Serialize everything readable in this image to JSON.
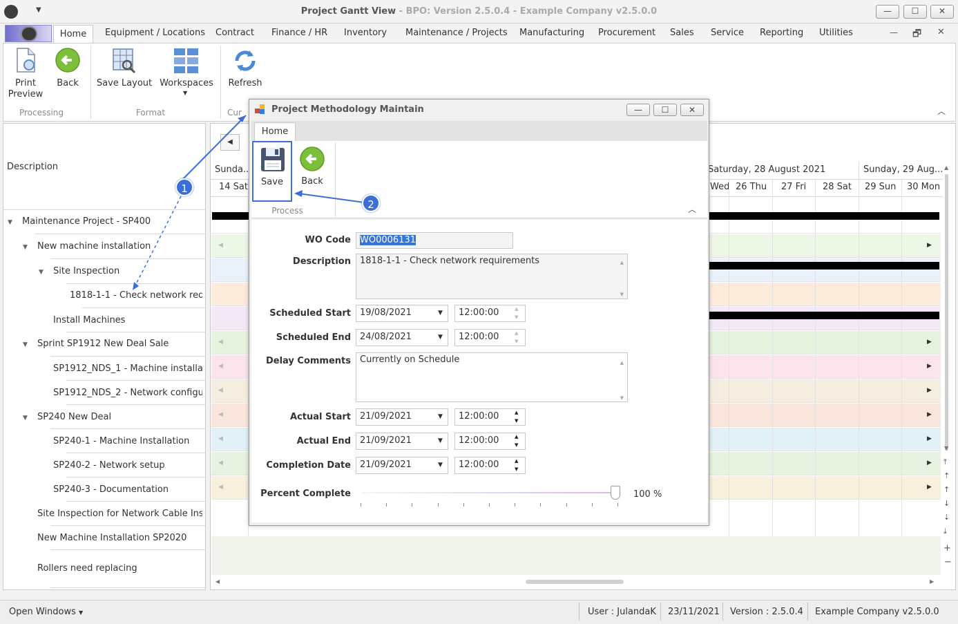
{
  "window": {
    "title": "Project Gantt View",
    "subtitle": "- BPO: Version 2.5.0.4 - Example Company v2.5.0.0",
    "minimize": "—",
    "maximize": "☐",
    "close": "✕"
  },
  "menu": {
    "items": [
      "Home",
      "Equipment / Locations",
      "Contract",
      "Finance / HR",
      "Inventory",
      "Maintenance / Projects",
      "Manufacturing",
      "Procurement",
      "Sales",
      "Service",
      "Reporting",
      "Utilities"
    ],
    "mdi_min": "—",
    "mdi_restore": "🗗",
    "mdi_close": "✕"
  },
  "ribbon": {
    "print_preview_line1": "Print",
    "print_preview_line2": "Preview",
    "back": "Back",
    "save_layout": "Save Layout",
    "workspaces": "Workspaces",
    "refresh": "Refresh",
    "group_processing": "Processing",
    "group_format": "Format",
    "group_cur": "Cur"
  },
  "tree": {
    "header": "Description",
    "items": [
      {
        "label": "Maintenance Project - SP400",
        "level": 0,
        "caret": "▼"
      },
      {
        "label": "New machine installation",
        "level": 1,
        "caret": "▼"
      },
      {
        "label": "Site Inspection",
        "level": 2,
        "caret": "▼"
      },
      {
        "label": "1818-1-1 - Check network req...",
        "level": 3,
        "caret": ""
      },
      {
        "label": "Install Machines",
        "level": 2,
        "caret": ""
      },
      {
        "label": "Sprint SP1912 New Deal Sale",
        "level": 1,
        "caret": "▼"
      },
      {
        "label": "SP1912_NDS_1 - Machine installat...",
        "level": 2,
        "caret": ""
      },
      {
        "label": "SP1912_NDS_2 - Network configu...",
        "level": 2,
        "caret": ""
      },
      {
        "label": "SP240 New Deal",
        "level": 1,
        "caret": "▼"
      },
      {
        "label": "SP240-1 - Machine Installation",
        "level": 2,
        "caret": ""
      },
      {
        "label": "SP240-2 - Network setup",
        "level": 2,
        "caret": ""
      },
      {
        "label": "SP240-3 - Documentation",
        "level": 2,
        "caret": ""
      },
      {
        "label": "Site Inspection for Network Cable Ins...",
        "level": 1,
        "caret": ""
      },
      {
        "label": "New Machine Installation SP2020",
        "level": 1,
        "caret": ""
      },
      {
        "label": "Rollers need replacing",
        "level": 1,
        "caret": ""
      }
    ]
  },
  "gantt": {
    "left_day_header": "Sunda...",
    "left_day": "14 Sat",
    "date_header_1": "Saturday, 28 August 2021",
    "date_header_2": "Sunday, 29 Aug...",
    "days": [
      "Wed",
      "26 Thu",
      "27 Fri",
      "28 Sat",
      "29 Sun",
      "30 Mon"
    ],
    "row_colors": [
      "#ffffff",
      "#edf7e6",
      "#e9f2fa",
      "#fdebdc",
      "#f3e8f6",
      "#e5f4df",
      "#fbe4ec",
      "#f5eee0",
      "#fbe6de",
      "#e2f1f8",
      "#e7f3e0",
      "#f8f0dc"
    ]
  },
  "dialog": {
    "title": "Project Methodology Maintain",
    "tab": "Home",
    "save": "Save",
    "back": "Back",
    "group_process": "Process",
    "fields": {
      "wo_code_label": "WO Code",
      "wo_code": "WO0006131",
      "description_label": "Description",
      "description": "1818-1-1 - Check network requirements",
      "sched_start_label": "Scheduled Start",
      "sched_start_date": "19/08/2021",
      "sched_start_time": "12:00:00",
      "sched_end_label": "Scheduled End",
      "sched_end_date": "24/08/2021",
      "sched_end_time": "12:00:00",
      "delay_label": "Delay Comments",
      "delay": "Currently on Schedule",
      "actual_start_label": "Actual Start",
      "actual_start_date": "21/09/2021",
      "actual_start_time": "12:00:00",
      "actual_end_label": "Actual End",
      "actual_end_date": "21/09/2021",
      "actual_end_time": "12:00:00",
      "completion_label": "Completion Date",
      "completion_date": "21/09/2021",
      "completion_time": "12:00:00",
      "percent_label": "Percent Complete",
      "percent_value": "100 %",
      "percent_fraction": 1.0
    }
  },
  "callouts": {
    "one": "1",
    "two": "2"
  },
  "status": {
    "open_windows": "Open Windows",
    "user": "User : JulandaK",
    "date": "23/11/2021",
    "version": "Version : 2.5.0.4",
    "company": "Example Company v2.5.0.0"
  },
  "colors": {
    "accent": "#3b6fd6",
    "green_icon": "#7cbf3a",
    "selection": "#3874d8"
  }
}
